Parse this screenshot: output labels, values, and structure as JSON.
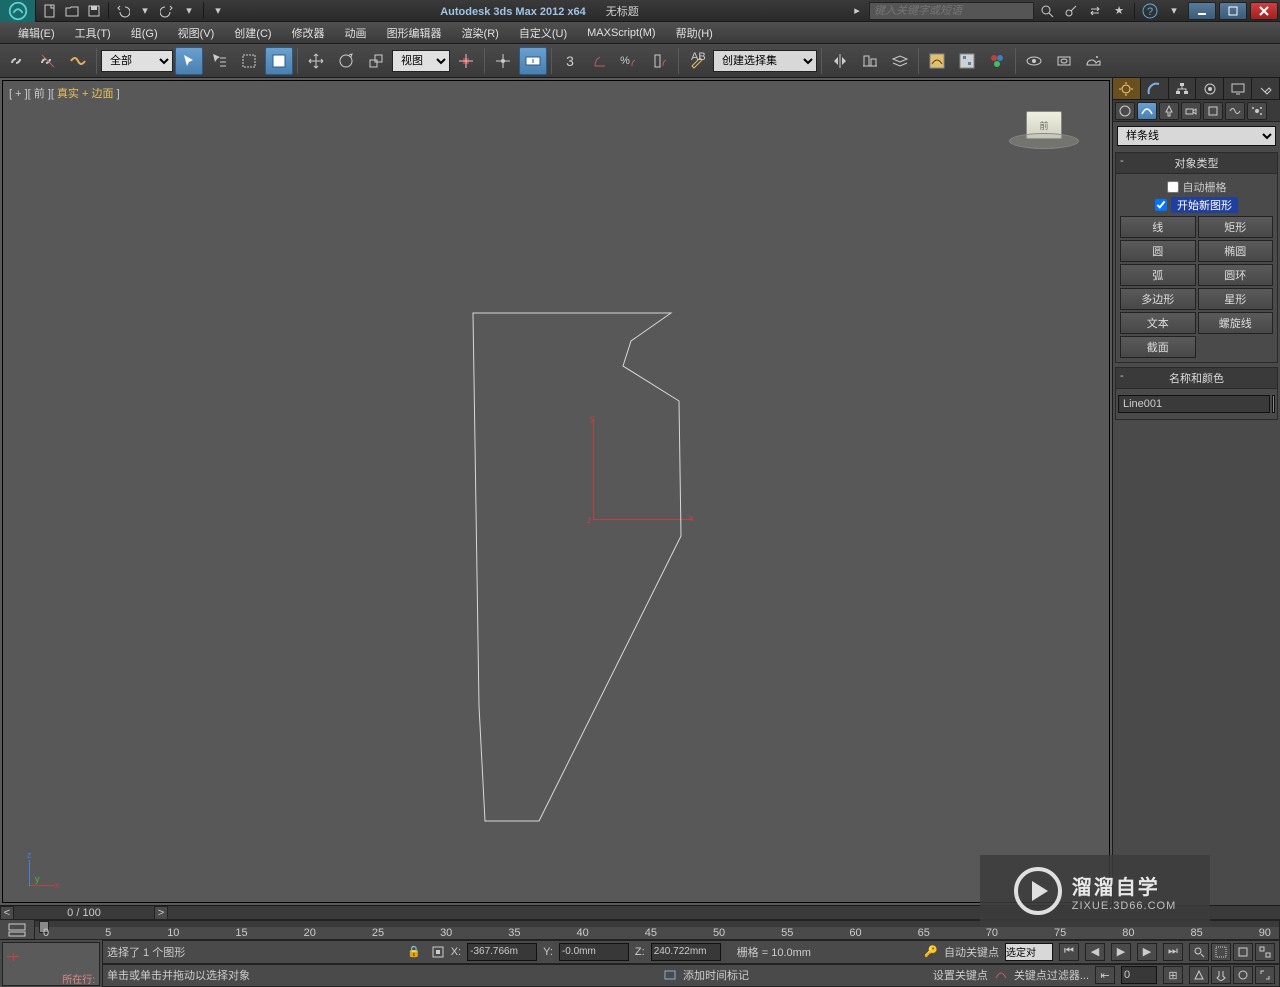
{
  "title": {
    "app": "Autodesk 3ds Max  2012 x64",
    "doc": "无标题",
    "search_placeholder": "键入关键字或短语"
  },
  "menu": {
    "edit": "编辑(E)",
    "tools": "工具(T)",
    "group": "组(G)",
    "views": "视图(V)",
    "create": "创建(C)",
    "modifiers": "修改器",
    "anim": "动画",
    "graph": "图形编辑器",
    "render": "渲染(R)",
    "custom": "自定义(U)",
    "maxscript": "MAXScript(M)",
    "help": "帮助(H)"
  },
  "toolbar": {
    "filter_all": "全部",
    "ref_view": "视图",
    "named_sel": "创建选择集",
    "digit3": "3"
  },
  "viewport": {
    "label_prefix": "[ + ][ 前 ][ ",
    "label_hl": "真实 + 边面",
    "label_suffix": " ]",
    "cube_face": "前"
  },
  "panel": {
    "dropdown": "样条线",
    "rollout_type": "对象类型",
    "auto_grid": "自动栅格",
    "start_new": "开始新图形",
    "buttons": {
      "line": "线",
      "rect": "矩形",
      "circle": "圆",
      "ellipse": "椭圆",
      "arc": "弧",
      "donut": "圆环",
      "ngon": "多边形",
      "star": "星形",
      "text": "文本",
      "helix": "螺旋线",
      "section": "截面"
    },
    "rollout_name": "名称和颜色",
    "obj_name": "Line001"
  },
  "track": {
    "left": "<",
    "right": ">",
    "pos": "0 / 100",
    "ticks": [
      "0",
      "5",
      "10",
      "15",
      "20",
      "25",
      "30",
      "35",
      "40",
      "45",
      "50",
      "55",
      "60",
      "65",
      "70",
      "75",
      "80",
      "85",
      "90"
    ]
  },
  "status": {
    "sel": "选择了 1 个图形",
    "hint": "单击或单击并拖动以选择对象",
    "x": "X:",
    "y": "Y:",
    "z": "Z:",
    "xv": "-367.766m",
    "yv": "-0.0mm",
    "zv": "240.722mm",
    "grid": "栅格 = 10.0mm",
    "autokey": "自动关键点",
    "sel_obj": "选定对",
    "setkey": "设置关键点",
    "keyfilter": "关键点过滤器...",
    "frame": "0",
    "add_tag": "添加时间标记",
    "nowdraw": "所在行:"
  },
  "watermark": {
    "line1": "溜溜自学",
    "line2": "ZIXUE.3D66.COM"
  }
}
